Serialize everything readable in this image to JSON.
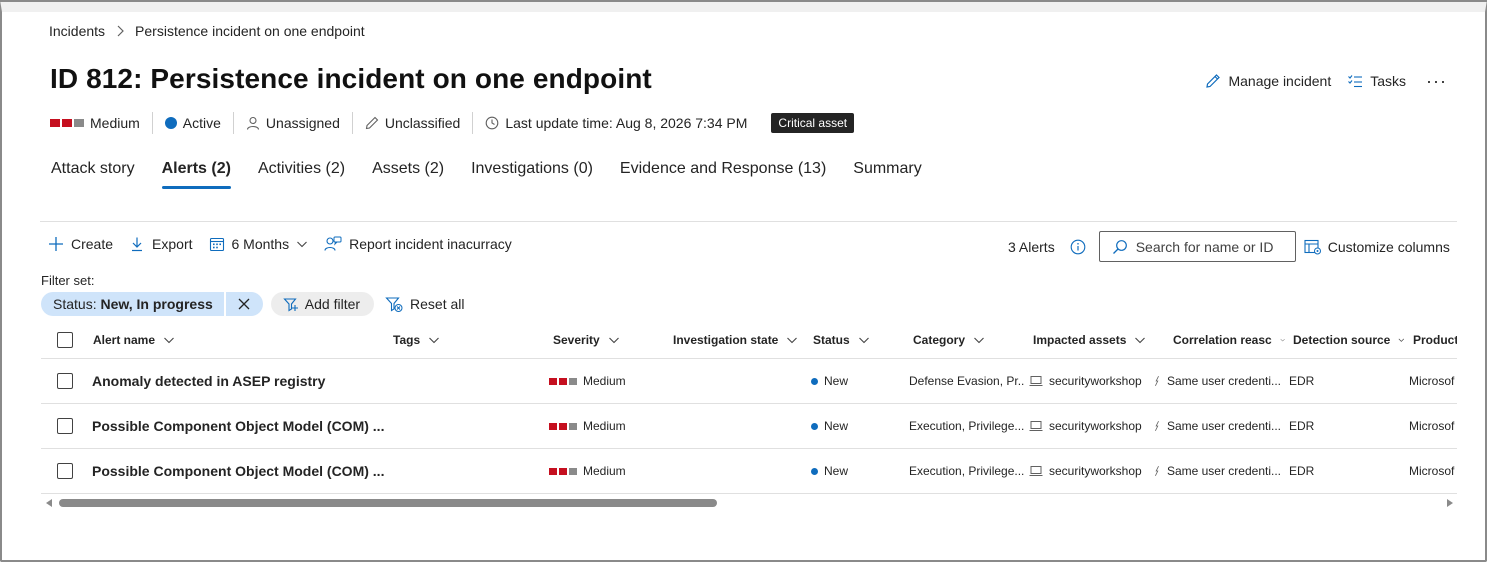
{
  "breadcrumb": {
    "parent": "Incidents",
    "current": "Persistence incident on one endpoint"
  },
  "title": "ID 812: Persistence incident on one endpoint",
  "top_actions": {
    "manage_label": "Manage incident",
    "tasks_label": "Tasks",
    "more_label": "···"
  },
  "meta": {
    "severity": "Medium",
    "status": "Active",
    "assigned": "Unassigned",
    "classification": "Unclassified",
    "last_update": "Last update time: Aug 8, 2026 7:34 PM",
    "badge": "Critical asset"
  },
  "tabs": [
    {
      "label": "Attack story"
    },
    {
      "label": "Alerts (2)"
    },
    {
      "label": "Activities (2)"
    },
    {
      "label": "Assets (2)"
    },
    {
      "label": "Investigations (0)"
    },
    {
      "label": "Evidence and Response (13)"
    },
    {
      "label": "Summary"
    }
  ],
  "active_tab": "Alerts (2)",
  "toolbar": {
    "create_label": "Create",
    "export_label": "Export",
    "range_label": "6 Months",
    "report_label": "Report incident inacurracy",
    "count_label": "3 Alerts",
    "search_placeholder": "Search for name or ID",
    "customize_label": "Customize columns"
  },
  "filters": {
    "set_label": "Filter set:",
    "status_key": "Status:",
    "status_value": "New, In progress",
    "add_label": "Add filter",
    "reset_label": "Reset all"
  },
  "table": {
    "columns": [
      "Alert name",
      "Tags",
      "Severity",
      "Investigation state",
      "Status",
      "Category",
      "Impacted assets",
      "Correlation reasc",
      "Detection source",
      "Product"
    ],
    "rows": [
      {
        "name": "Anomaly detected in ASEP registry",
        "severity": "Medium",
        "status": "New",
        "category": "Defense Evasion, Pr...",
        "asset": "securityworkshop",
        "correlation": "Same user credenti...",
        "source": "EDR",
        "product": "Microsof"
      },
      {
        "name": "Possible Component Object Model (COM) ...",
        "severity": "Medium",
        "status": "New",
        "category": "Execution, Privilege...",
        "asset": "securityworkshop",
        "correlation": "Same user credenti...",
        "source": "EDR",
        "product": "Microsof"
      },
      {
        "name": "Possible Component Object Model (COM) ...",
        "severity": "Medium",
        "status": "New",
        "category": "Execution, Privilege...",
        "asset": "securityworkshop",
        "correlation": "Same user credenti...",
        "source": "EDR",
        "product": "Microsof"
      }
    ]
  },
  "scroll": {
    "horizontal_position": 0
  },
  "colors": {
    "accent": "#0f6cbd",
    "severity_high": "#c50f1f",
    "severity_off": "#8a8a8a",
    "filter_pill": "#cfe4fa",
    "badge": "#242424"
  },
  "icons": {
    "breadcrumb_sep": "chevron-right-icon",
    "manage": "pencil-icon",
    "tasks": "tasks-list-icon",
    "assigned": "person-icon",
    "classification": "pencil-icon",
    "last_update": "clock-icon",
    "create": "plus-icon",
    "export": "download-icon",
    "range": "calendar-icon",
    "report": "person-feedback-icon",
    "info": "info-icon",
    "search": "search-icon",
    "customize": "table-settings-icon",
    "add_filter": "filter-add-icon",
    "reset": "filter-reset-icon",
    "asset": "laptop-icon",
    "correlation": "link-icon"
  }
}
